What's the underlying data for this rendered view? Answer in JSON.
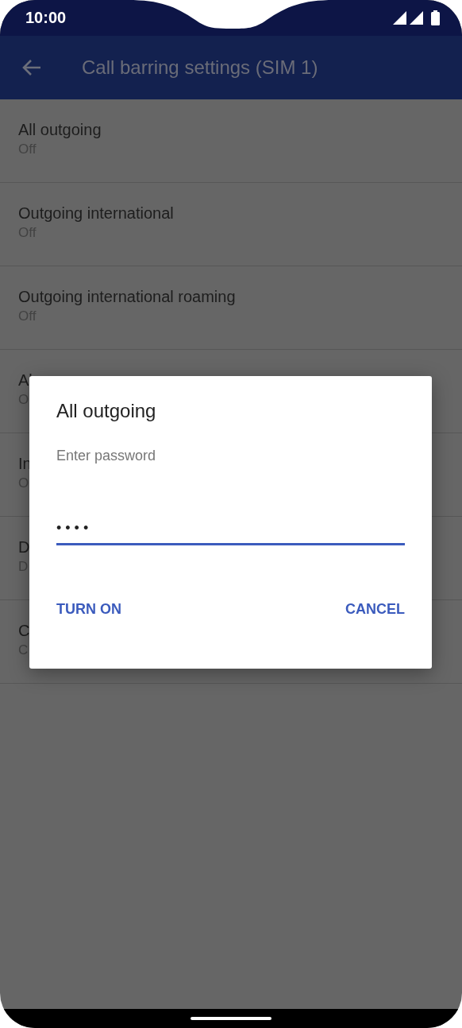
{
  "status_bar": {
    "time": "10:00"
  },
  "app_bar": {
    "title": "Call barring settings (SIM 1)"
  },
  "settings": [
    {
      "title": "All outgoing",
      "summary": "Off"
    },
    {
      "title": "Outgoing international",
      "summary": "Off"
    },
    {
      "title": "Outgoing international roaming",
      "summary": "Off"
    },
    {
      "title": "Al",
      "summary": "O"
    },
    {
      "title": "In",
      "summary": "O"
    },
    {
      "title": "D",
      "summary": "D"
    },
    {
      "title": "C",
      "summary": "C"
    }
  ],
  "dialog": {
    "title": "All outgoing",
    "field": {
      "label": "Enter password",
      "value": "••••"
    },
    "buttons": [
      "TURN ON",
      "CANCEL"
    ]
  }
}
